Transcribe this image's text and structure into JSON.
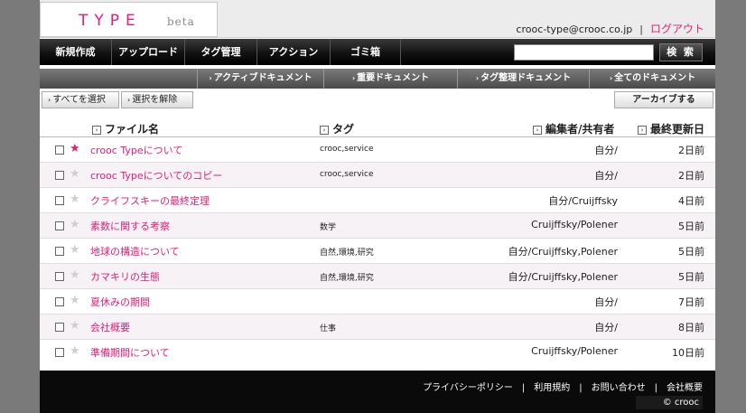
{
  "header": {
    "logo_type": "TYPE",
    "logo_beta": "beta",
    "user_email": "crooc-type@crooc.co.jp",
    "separator": "|",
    "logout_label": "ログアウト"
  },
  "mainnav": {
    "items": [
      "新規作成",
      "アップロード",
      "タグ管理",
      "アクション",
      "ゴミ箱"
    ],
    "search_placeholder": "",
    "search_button": "検 索"
  },
  "subnav": {
    "items": [
      "アクティブドキュメント",
      "重要ドキュメント",
      "タグ整理ドキュメント",
      "全てのドキュメント"
    ]
  },
  "actions": {
    "select_all": "すべてを選択",
    "deselect": "選択を解除",
    "archive": "アーカイブする"
  },
  "columns": {
    "filename": "ファイル名",
    "tag": "タグ",
    "owner": "編集者/共有者",
    "updated": "最終更新日"
  },
  "rows": [
    {
      "starred": true,
      "name": "crooc Typeについて",
      "tag": "crooc,service",
      "owner": "自分/",
      "updated": "2日前"
    },
    {
      "starred": false,
      "name": "crooc Typeについてのコピー",
      "tag": "crooc,service",
      "owner": "自分/",
      "updated": "2日前"
    },
    {
      "starred": false,
      "name": "クライフスキーの最終定理",
      "tag": "",
      "owner": "自分/Cruijffsky",
      "updated": "4日前"
    },
    {
      "starred": false,
      "name": "素数に関する考察",
      "tag": "数学",
      "owner": "Cruijffsky/Polener",
      "updated": "5日前"
    },
    {
      "starred": false,
      "name": "地球の構造について",
      "tag": "自然,環境,研究",
      "owner": "自分/Cruijffsky,Polener",
      "updated": "5日前"
    },
    {
      "starred": false,
      "name": "カマキリの生態",
      "tag": "自然,環境,研究",
      "owner": "自分/Cruijffsky,Polener",
      "updated": "5日前"
    },
    {
      "starred": false,
      "name": "夏休みの期間",
      "tag": "",
      "owner": "自分/",
      "updated": "7日前"
    },
    {
      "starred": false,
      "name": "会社概要",
      "tag": "仕事",
      "owner": "自分/",
      "updated": "8日前"
    },
    {
      "starred": false,
      "name": "準備期間について",
      "tag": "",
      "owner": "Cruijffsky/Polener",
      "updated": "10日前"
    }
  ],
  "footer": {
    "links": [
      "プライバシーポリシー",
      "利用規約",
      "お問い合わせ",
      "会社概要"
    ],
    "separator": "|",
    "copyright": "© crooc"
  },
  "colors": {
    "accent": "#e0207a",
    "page_bg": "#7a7a7a",
    "nav_bg": "#111111",
    "footer_bg": "#0a0a0a"
  }
}
